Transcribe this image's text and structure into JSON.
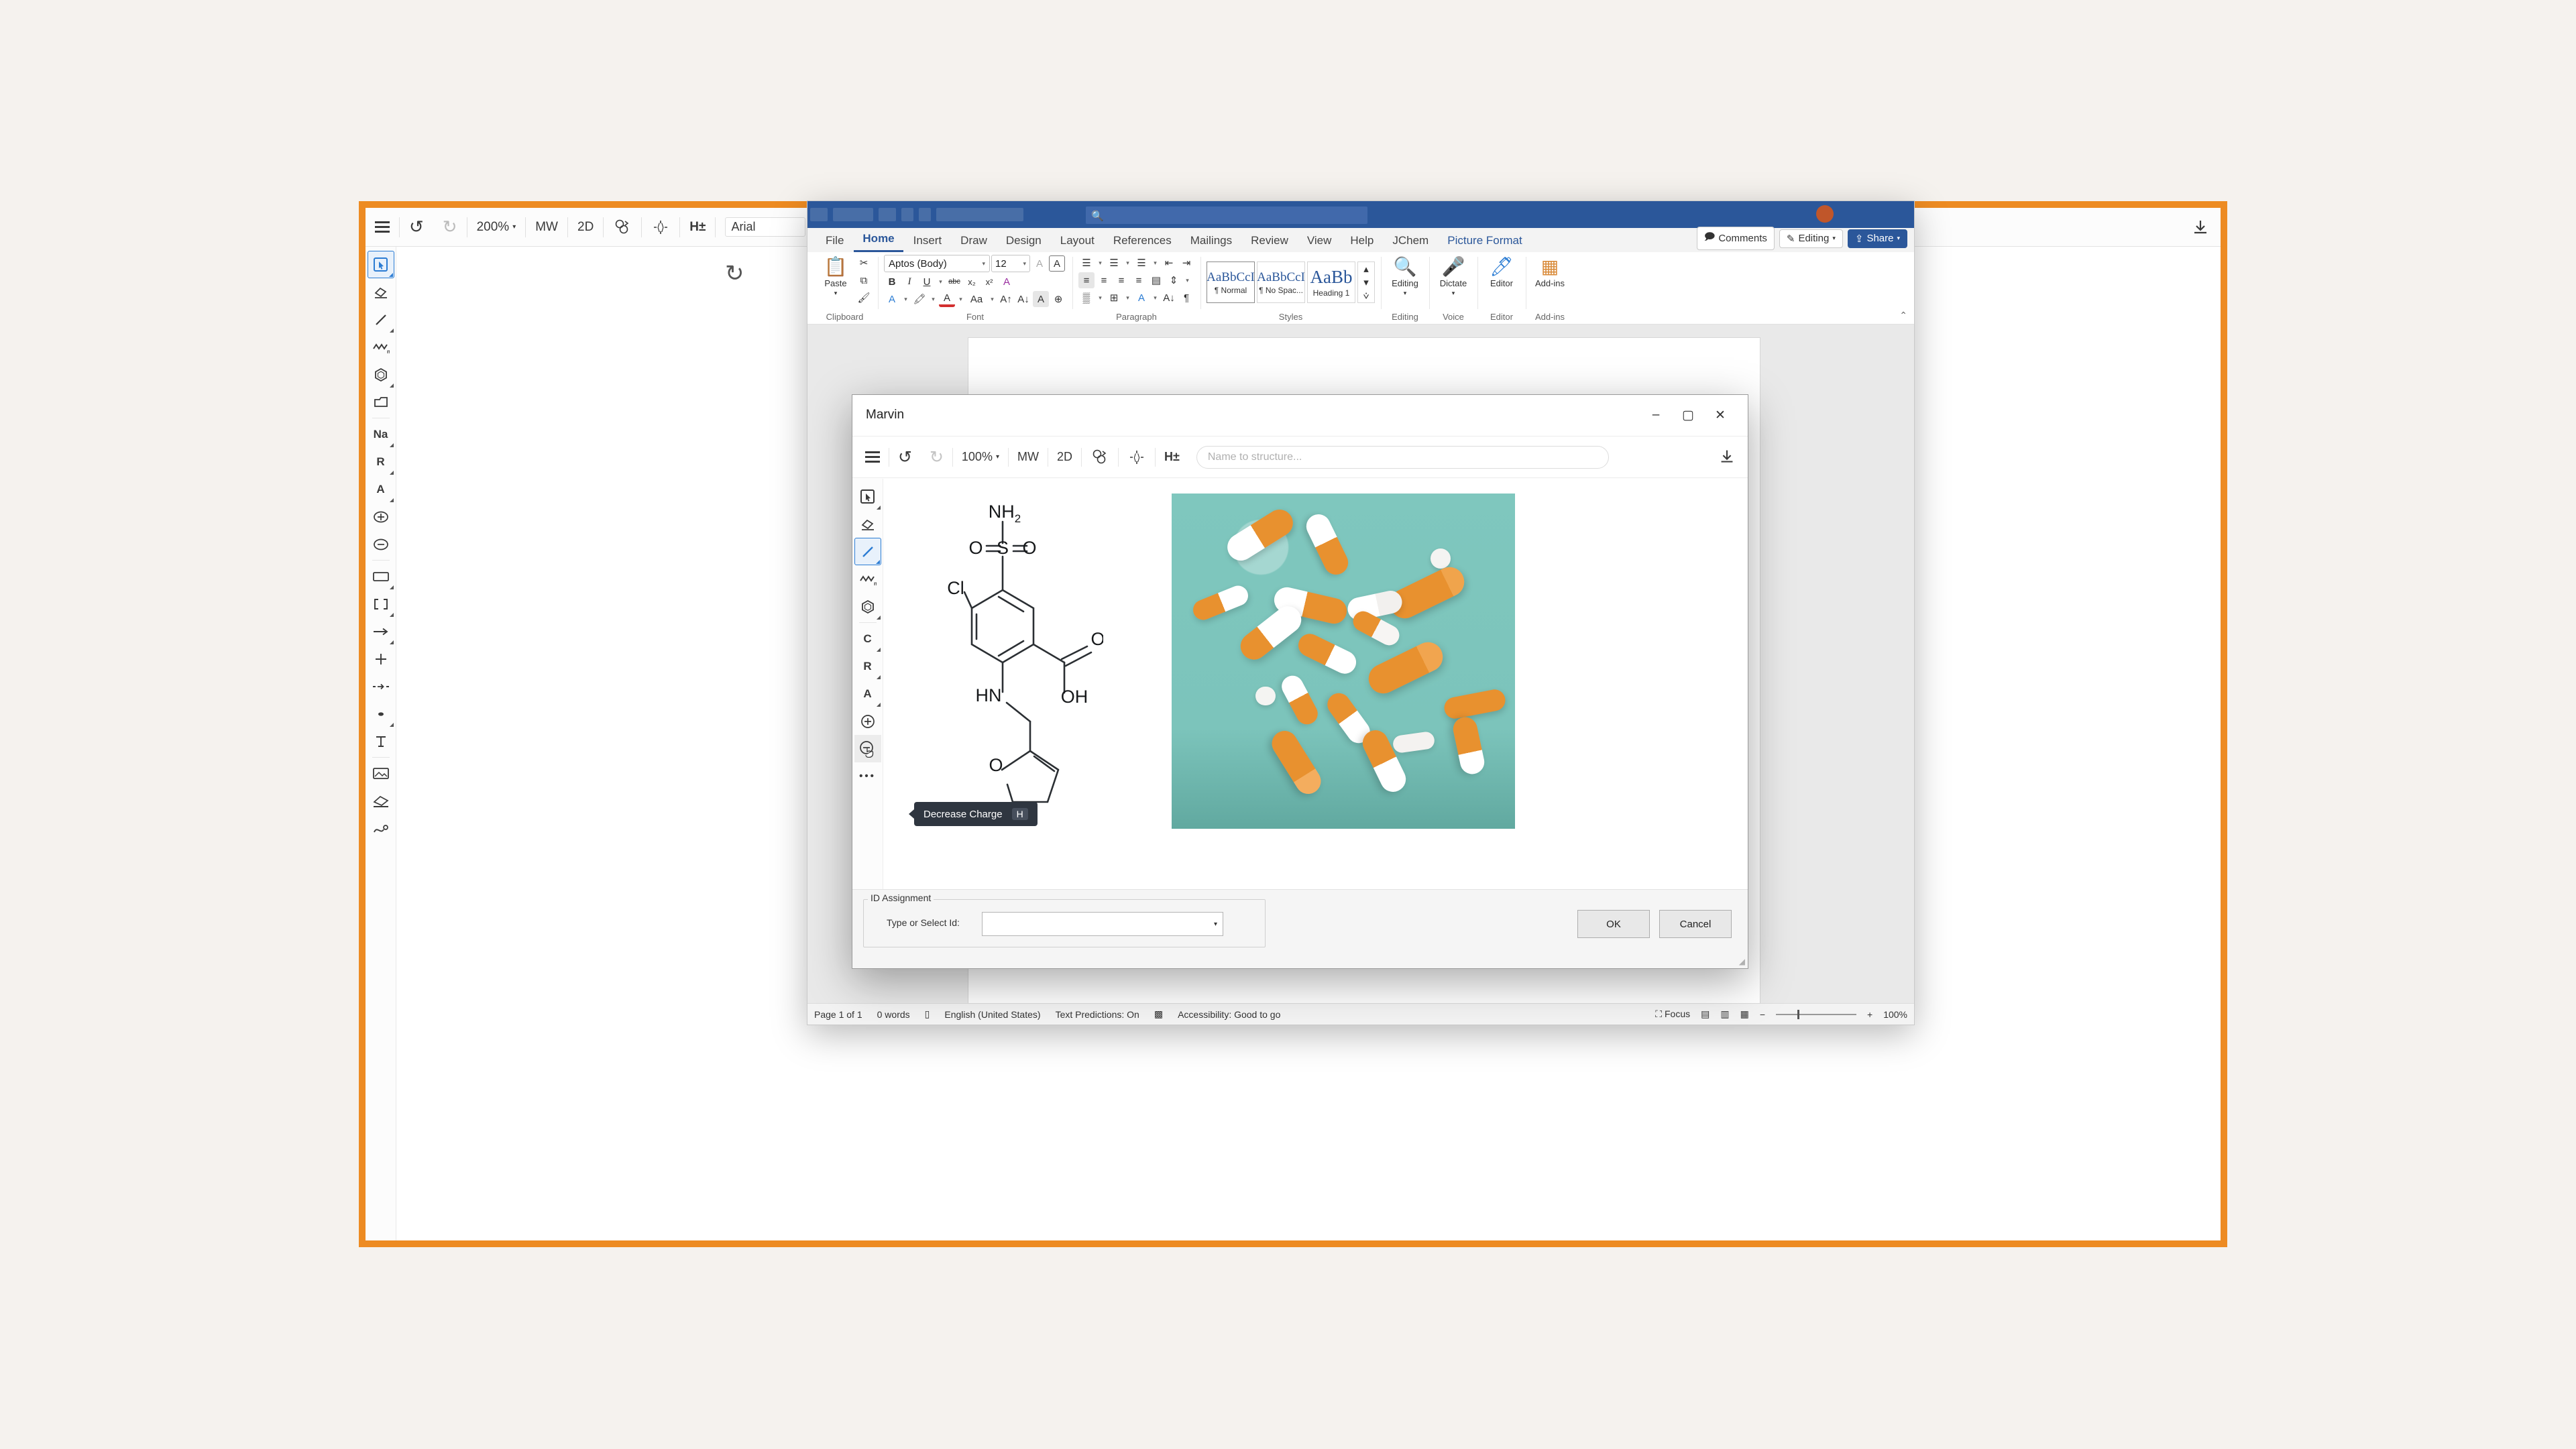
{
  "background_app": {
    "toolbar": {
      "menu_icon": "hamburger-icon",
      "undo": "↺",
      "redo": "↻",
      "zoom": "200%",
      "mw": "MW",
      "dim": "2D",
      "clean": "clean-2d-icon",
      "explicit_h": "H±",
      "font_value": "Arial",
      "download": "download-icon"
    },
    "rail_tools": [
      {
        "name": "selection-tool",
        "glyph": "⬓",
        "active": true
      },
      {
        "name": "eraser-tool",
        "glyph": "◇",
        "active": false
      },
      {
        "name": "bond-tool",
        "glyph": "╱",
        "active": false
      },
      {
        "name": "chain-tool",
        "glyph": "∿",
        "active": false
      },
      {
        "name": "ring-tool",
        "glyph": "⬡",
        "active": false
      },
      {
        "name": "template-tool",
        "glyph": "▱",
        "active": false
      },
      {
        "name": "atom-na",
        "glyph": "Na",
        "active": false
      },
      {
        "name": "r-group",
        "glyph": "R",
        "active": false
      },
      {
        "name": "atom-any",
        "glyph": "A",
        "active": false
      },
      {
        "name": "increase-charge",
        "glyph": "⊕",
        "active": false
      },
      {
        "name": "decrease-charge",
        "glyph": "⊖",
        "active": false
      },
      {
        "name": "bracket-box",
        "glyph": "▭",
        "active": false
      },
      {
        "name": "brackets",
        "glyph": "[ ]",
        "active": false
      },
      {
        "name": "arrow-tool",
        "glyph": "→",
        "active": false
      },
      {
        "name": "plus-tool",
        "glyph": "+",
        "active": false
      },
      {
        "name": "mapping-tool",
        "glyph": "⇹",
        "active": false
      },
      {
        "name": "dot-tool",
        "glyph": "•",
        "active": false
      },
      {
        "name": "text-tool",
        "glyph": "T",
        "active": false
      },
      {
        "name": "image-tool",
        "glyph": "▣",
        "active": false
      },
      {
        "name": "lasso-erase",
        "glyph": "◈",
        "active": false
      },
      {
        "name": "curve-tool",
        "glyph": "℈",
        "active": false
      }
    ],
    "refresh_icon": "↻"
  },
  "word": {
    "title_search_placeholder": "Search",
    "tabs": [
      {
        "label": "File",
        "active": false,
        "context": false
      },
      {
        "label": "Home",
        "active": true,
        "context": false
      },
      {
        "label": "Insert",
        "active": false,
        "context": false
      },
      {
        "label": "Draw",
        "active": false,
        "context": false
      },
      {
        "label": "Design",
        "active": false,
        "context": false
      },
      {
        "label": "Layout",
        "active": false,
        "context": false
      },
      {
        "label": "References",
        "active": false,
        "context": false
      },
      {
        "label": "Mailings",
        "active": false,
        "context": false
      },
      {
        "label": "Review",
        "active": false,
        "context": false
      },
      {
        "label": "View",
        "active": false,
        "context": false
      },
      {
        "label": "Help",
        "active": false,
        "context": false
      },
      {
        "label": "JChem",
        "active": false,
        "context": false
      },
      {
        "label": "Picture Format",
        "active": false,
        "context": true
      }
    ],
    "top_right": {
      "comments": "Comments",
      "editing": "Editing",
      "share": "Share"
    },
    "groups": {
      "clipboard": {
        "label": "Clipboard",
        "paste": "Paste"
      },
      "font": {
        "label": "Font",
        "font_name": "Aptos (Body)",
        "font_size": "12",
        "bold": "B",
        "italic": "I",
        "underline": "U",
        "strikethrough": "abc",
        "subscript": "x₂",
        "superscript": "x²",
        "clear_format": "A",
        "text_effects": "A",
        "highlight": "A",
        "font_color": "A",
        "change_case": "Aa",
        "grow_font": "A",
        "shrink_font": "A"
      },
      "paragraph": {
        "label": "Paragraph"
      },
      "styles": {
        "label": "Styles",
        "items": [
          {
            "sample": "AaBbCcI",
            "name": "¶ Normal",
            "selected": true
          },
          {
            "sample": "AaBbCcI",
            "name": "¶ No Spac...",
            "selected": false
          },
          {
            "sample": "AaBb",
            "name": "Heading 1",
            "selected": false
          }
        ]
      },
      "editing": {
        "label": "Editing",
        "button": "Editing"
      },
      "voice": {
        "label": "Voice",
        "button": "Dictate"
      },
      "editor": {
        "label": "Editor",
        "button": "Editor"
      },
      "addins": {
        "label": "Add-ins",
        "button": "Add-ins"
      }
    },
    "status": {
      "page": "Page 1 of 1",
      "words": "0 words",
      "language": "English (United States)",
      "predictions": "Text Predictions: On",
      "accessibility": "Accessibility: Good to go",
      "focus": "Focus",
      "zoom": "100%"
    }
  },
  "marvin": {
    "title": "Marvin",
    "window_buttons": {
      "minimize": "–",
      "maximize": "▢",
      "close": "✕"
    },
    "toolbar": {
      "menu_icon": "hamburger-icon",
      "undo": "↺",
      "redo": "↻",
      "zoom": "100%",
      "mw": "MW",
      "dim": "2D",
      "clean": "clean-2d-icon",
      "explicit_h": "H±",
      "name_placeholder": "Name to structure...",
      "download": "download-icon"
    },
    "rail_tools": [
      {
        "name": "selection-tool",
        "glyph": "⬓",
        "active": false,
        "arrow": true
      },
      {
        "name": "eraser-tool",
        "glyph": "◇",
        "active": false,
        "arrow": false
      },
      {
        "name": "bond-tool",
        "glyph": "╱",
        "active": true,
        "arrow": true
      },
      {
        "name": "chain-tool",
        "glyph": "∿",
        "active": false,
        "arrow": false
      },
      {
        "name": "ring-tool",
        "glyph": "⬡",
        "active": false,
        "arrow": true
      },
      {
        "name": "atom-c",
        "glyph": "C",
        "active": false,
        "arrow": true
      },
      {
        "name": "r-group",
        "glyph": "R",
        "active": false,
        "arrow": true
      },
      {
        "name": "atom-any",
        "glyph": "A",
        "active": false,
        "arrow": true
      },
      {
        "name": "increase-charge",
        "glyph": "⊕",
        "active": false,
        "arrow": false
      },
      {
        "name": "decrease-charge",
        "glyph": "⊖",
        "active": true,
        "arrow": false
      },
      {
        "name": "more-tools",
        "glyph": "•••",
        "active": false,
        "arrow": false
      }
    ],
    "tooltip": {
      "label": "Decrease Charge",
      "shortcut": "H"
    },
    "footer": {
      "group_label": "ID Assignment",
      "field_label": "Type or Select Id:",
      "field_value": "",
      "ok": "OK",
      "cancel": "Cancel"
    }
  },
  "structure": {
    "labels": {
      "nh2": "NH₂",
      "o_left": "O",
      "s": "S",
      "o_right": "O",
      "cl": "Cl",
      "o_carbonyl": "O",
      "oh": "OH",
      "hn": "HN",
      "o_furan": "O"
    }
  },
  "colors": {
    "frame_orange": "#ED8B22",
    "word_blue": "#2b579a",
    "teal": "#7fc7be",
    "pill_orange": "#E8912F",
    "tooltip_bg": "#2f3640",
    "selection_blue": "#cfe3f7"
  }
}
